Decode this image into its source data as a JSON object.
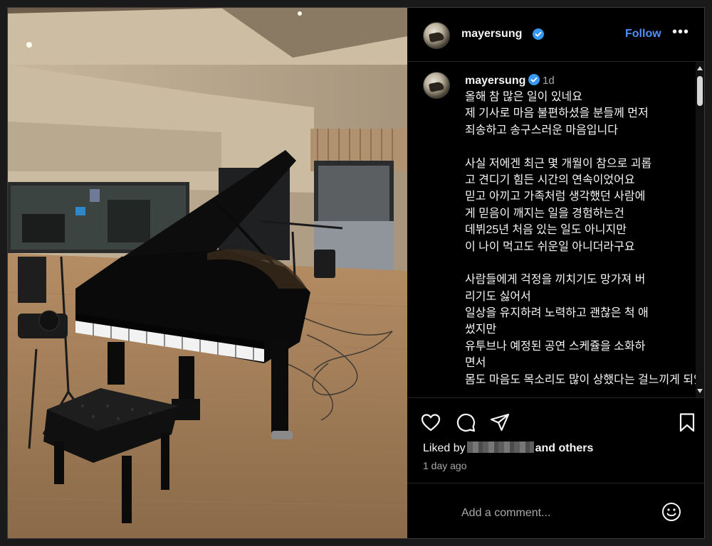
{
  "post": {
    "username": "mayersung",
    "verified": true,
    "follow_label": "Follow",
    "more_icon": "more-options-icon"
  },
  "caption": {
    "username": "mayersung",
    "time": "1d",
    "lines": [
      "올해 참 많은 일이 있네요",
      "제 기사로 마음 불편하셨을 분들께 먼저",
      "죄송하고 송구스러운 마음입니다",
      "",
      "사실 저에겐 최근 몇 개월이 참으로 괴롭",
      "고 견디기 힘든 시간의 연속이었어요",
      "믿고 아끼고 가족처럼 생각했던 사람에",
      "게 믿음이 깨지는 일을 경험하는건",
      "데뷔25년 처음 있는 일도 아니지만",
      "이 나이 먹고도 쉬운일 아니더라구요",
      "",
      "사람들에게 걱정을 끼치기도 망가져 버",
      "리기도 싫어서",
      "일상을 유지하려 노력하고 괜찮은 척 애",
      "썼지만",
      "유투브나 예정된 공연 스케쥴을 소화하",
      "면서",
      "몸도 마음도 목소리도 많이 상했다는 걸느끼게 되었어요"
    ]
  },
  "actions": {
    "icons": [
      "heart-icon",
      "comment-icon",
      "share-icon",
      "bookmark-icon"
    ]
  },
  "likes": {
    "prefix": "Liked by",
    "suffix": "and others"
  },
  "time_ago": "1 day ago",
  "comment": {
    "placeholder": "Add a comment..."
  },
  "colors": {
    "background": "#000000",
    "accent": "#4f8ff7",
    "verified_badge": "#3897f0",
    "secondary_text": "#a8a8a8"
  }
}
